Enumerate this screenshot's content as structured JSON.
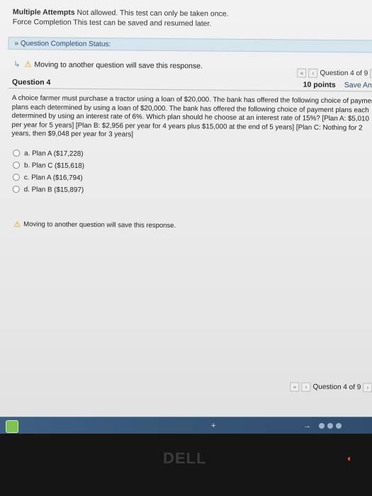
{
  "header": {
    "multiple_attempts_label": "Multiple Attempts",
    "multiple_attempts_text": "Not allowed. This test can only be taken once.",
    "force_completion_label": "Force Completion",
    "force_completion_text": "This test can be saved and resumed later."
  },
  "status": {
    "label": "Question Completion Status:"
  },
  "notice": {
    "moving_text": "Moving to another question will save this response."
  },
  "navigation": {
    "top": "Question 4 of 9",
    "bottom": "Question 4 of 9"
  },
  "question": {
    "title": "Question 4",
    "points": "10 points",
    "save_label": "Save Answer",
    "text": "A choice farmer must purchase a tractor using a loan of $20,000. The bank has offered the following choice of payment plans each determined by using a loan of $20,000. The bank has offered the following choice of payment plans each determined by using an interest rate of 6%. Which plan should he choose at an interest rate of 15%? [Plan A: $5,010 per year for 5 years] [Plan B: $2,956 per year for 4 years plus $15,000 at the end of 5 years] [Plan C: Nothing for 2 years, then $9,048 per year for 3 years]",
    "options": [
      {
        "label": "a. Plan A ($17,228)"
      },
      {
        "label": "b. Plan C ($15,618)"
      },
      {
        "label": "c. Plan A ($16,794)"
      },
      {
        "label": "d. Plan B ($15,897)"
      }
    ]
  },
  "footer": {
    "moving_text": "Moving to another question will save this response."
  },
  "colors": {
    "status_bar": "#d6e4ee",
    "link_blue": "#2a4b74",
    "warning": "#d99800",
    "taskbar": "#3e5f80"
  },
  "bezel": {
    "logo_text": "DELL"
  }
}
